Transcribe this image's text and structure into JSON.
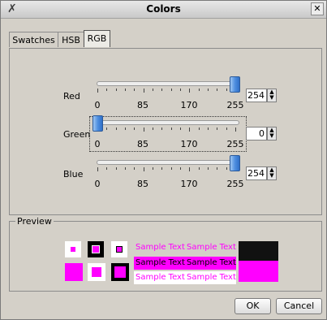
{
  "window": {
    "title": "Colors"
  },
  "titlebar": {
    "close_glyph": "✕",
    "app_icon": "app-icon"
  },
  "tabs": [
    {
      "label": "Swatches",
      "active": false
    },
    {
      "label": "HSB",
      "active": false
    },
    {
      "label": "RGB",
      "active": true
    }
  ],
  "sliders": [
    {
      "label": "Red",
      "value": 254,
      "field": "254"
    },
    {
      "label": "Green",
      "value": 0,
      "field": "0"
    },
    {
      "label": "Blue",
      "value": 254,
      "field": "254"
    }
  ],
  "scale": {
    "ticks": [
      "0",
      "85",
      "170",
      "255"
    ],
    "max": 255
  },
  "preview": {
    "legend": "Preview",
    "sample_text": "Sample Text",
    "colors": {
      "selected": "#ff00ff",
      "black": "#000000",
      "white": "#ffffff"
    }
  },
  "buttons": {
    "ok": "OK",
    "cancel": "Cancel"
  }
}
